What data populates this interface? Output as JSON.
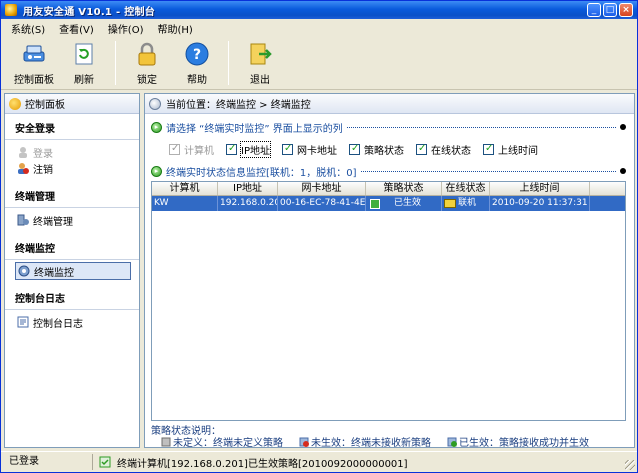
{
  "window": {
    "title": "用友安全通 V10.1 - 控制台",
    "min": "_",
    "max": "□",
    "close": "×"
  },
  "menu": [
    {
      "label": "系统(S)"
    },
    {
      "label": "查看(V)"
    },
    {
      "label": "操作(O)"
    },
    {
      "label": "帮助(H)"
    }
  ],
  "toolbar": {
    "control_panel": "控制面板",
    "refresh": "刷新",
    "lock": "锁定",
    "help": "帮助",
    "exit": "退出"
  },
  "sidebar": {
    "header": "控制面板",
    "groups": [
      {
        "title": "安全登录",
        "items": [
          {
            "label": "登录",
            "disabled": true
          },
          {
            "label": "注销"
          }
        ]
      },
      {
        "title": "终端管理",
        "items": [
          {
            "label": "终端管理"
          }
        ]
      },
      {
        "title": "终端监控",
        "items": [
          {
            "label": "终端监控",
            "selected": true
          }
        ]
      },
      {
        "title": "控制台日志",
        "items": [
          {
            "label": "控制台日志"
          }
        ]
      }
    ]
  },
  "main": {
    "breadcrumb": "当前位置：终端监控 > 终端监控",
    "section1": "请选择 “终端实时监控” 界面上显示的列",
    "columns_options": [
      {
        "label": "计算机",
        "checked": true,
        "disabled": true
      },
      {
        "label": "IP地址",
        "checked": true
      },
      {
        "label": "网卡地址",
        "checked": true
      },
      {
        "label": "策略状态",
        "checked": true
      },
      {
        "label": "在线状态",
        "checked": true
      },
      {
        "label": "上线时间",
        "checked": true
      }
    ],
    "section2": "终端实时状态信息监控[联机：1，脱机：0]",
    "table": {
      "headers": [
        "计算机",
        "IP地址",
        "网卡地址",
        "策略状态",
        "在线状态",
        "上线时间"
      ],
      "rows": [
        {
          "computer": "KW",
          "ip": "192.168.0.20",
          "mac": "00-16-EC-78-41-4E",
          "policy": "已生效",
          "online": "联机",
          "time": "2010-09-20 11:37:31"
        }
      ]
    },
    "legend_title": "策略状态说明：",
    "legend": [
      "未定义：终端未定义策略",
      "未生效：终端未接收新策略",
      "已生效：策略接收成功并生效"
    ]
  },
  "statusbar": {
    "left": "已登录",
    "message": "终端计算机[192.168.0.201]已生效策略[2010092000000001]"
  },
  "colors": {
    "title_blue": "#0a5bdc",
    "selection_blue": "#316ac5",
    "section_green": "#2d9b23"
  }
}
